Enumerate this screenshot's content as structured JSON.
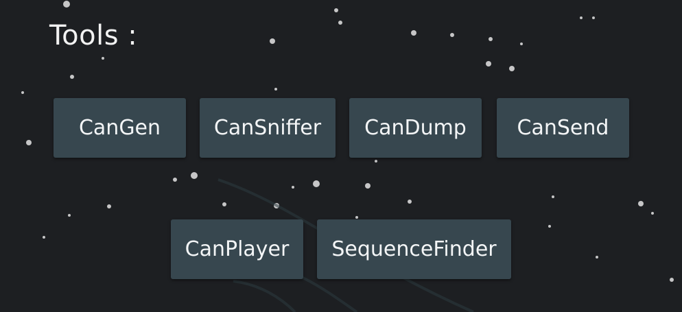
{
  "title": "Tools :",
  "buttons_row1": [
    {
      "label": "CanGen"
    },
    {
      "label": "CanSniffer"
    },
    {
      "label": "CanDump"
    },
    {
      "label": "CanSend"
    }
  ],
  "buttons_row2": [
    {
      "label": "CanPlayer"
    },
    {
      "label": "SequenceFinder"
    }
  ],
  "colors": {
    "background": "#1d1f22",
    "button_bg": "#37474f",
    "text": "#f3f5f6"
  }
}
